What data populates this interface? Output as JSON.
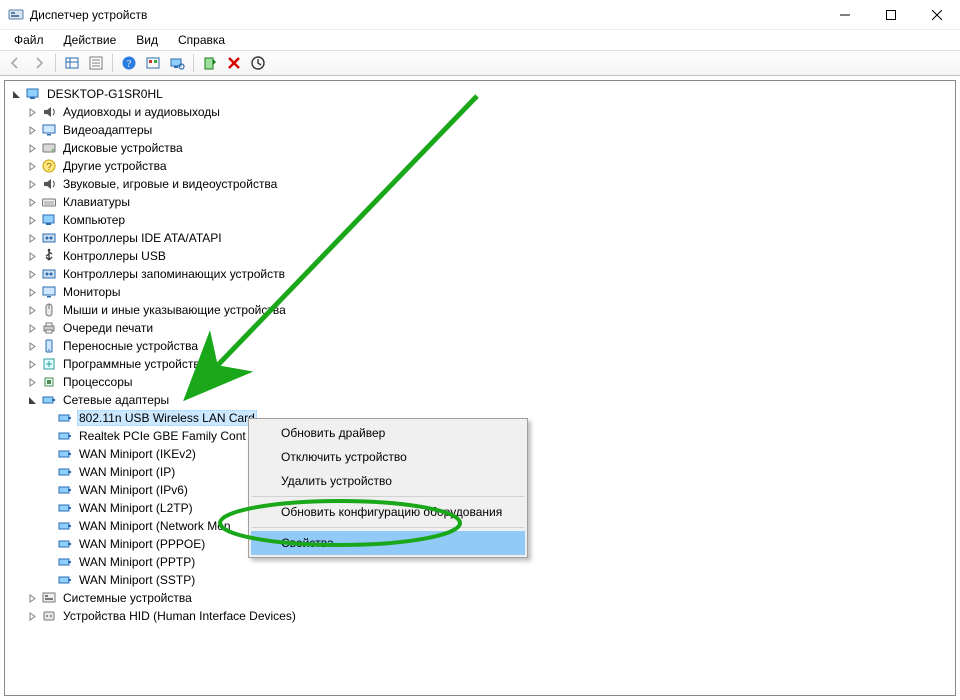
{
  "window": {
    "title": "Диспетчер устройств"
  },
  "menu": {
    "file": "Файл",
    "action": "Действие",
    "view": "Вид",
    "help": "Справка"
  },
  "tree": {
    "root": "DESKTOP-G1SR0HL",
    "categories": [
      {
        "label": "Аудиовходы и аудиовыходы",
        "icon": "audio"
      },
      {
        "label": "Видеоадаптеры",
        "icon": "display"
      },
      {
        "label": "Дисковые устройства",
        "icon": "disk"
      },
      {
        "label": "Другие устройства",
        "icon": "unknown"
      },
      {
        "label": "Звуковые, игровые и видеоустройства",
        "icon": "audio"
      },
      {
        "label": "Клавиатуры",
        "icon": "keyboard"
      },
      {
        "label": "Компьютер",
        "icon": "computer"
      },
      {
        "label": "Контроллеры IDE ATA/ATAPI",
        "icon": "storage-ctrl"
      },
      {
        "label": "Контроллеры USB",
        "icon": "usb"
      },
      {
        "label": "Контроллеры запоминающих устройств",
        "icon": "storage-ctrl"
      },
      {
        "label": "Мониторы",
        "icon": "monitor"
      },
      {
        "label": "Мыши и иные указывающие устройства",
        "icon": "mouse"
      },
      {
        "label": "Очереди печати",
        "icon": "printer"
      },
      {
        "label": "Переносные устройства",
        "icon": "portable"
      },
      {
        "label": "Программные устройства",
        "icon": "software"
      },
      {
        "label": "Процессоры",
        "icon": "cpu"
      },
      {
        "label": "Сетевые адаптеры",
        "icon": "network",
        "expanded": true,
        "children": [
          {
            "label": "802.11n USB Wireless LAN Card",
            "selected": true,
            "truncated": true
          },
          {
            "label": "Realtek PCIe GBE Family Cont",
            "truncated": true
          },
          {
            "label": "WAN Miniport (IKEv2)"
          },
          {
            "label": "WAN Miniport (IP)"
          },
          {
            "label": "WAN Miniport (IPv6)"
          },
          {
            "label": "WAN Miniport (L2TP)"
          },
          {
            "label": "WAN Miniport (Network Mon",
            "truncated": true
          },
          {
            "label": "WAN Miniport (PPPOE)"
          },
          {
            "label": "WAN Miniport (PPTP)"
          },
          {
            "label": "WAN Miniport (SSTP)"
          }
        ]
      },
      {
        "label": "Системные устройства",
        "icon": "system"
      },
      {
        "label": "Устройства HID (Human Interface Devices)",
        "icon": "hid"
      }
    ]
  },
  "context_menu": {
    "items": [
      "Обновить драйвер",
      "Отключить устройство",
      "Удалить устройство",
      "Обновить конфигурацию оборудования",
      "Свойства"
    ],
    "highlighted_index": 4
  },
  "colors": {
    "annotation": "#1aa81a",
    "selection": "#cce8ff",
    "menu_highlight": "#91c9f7"
  }
}
